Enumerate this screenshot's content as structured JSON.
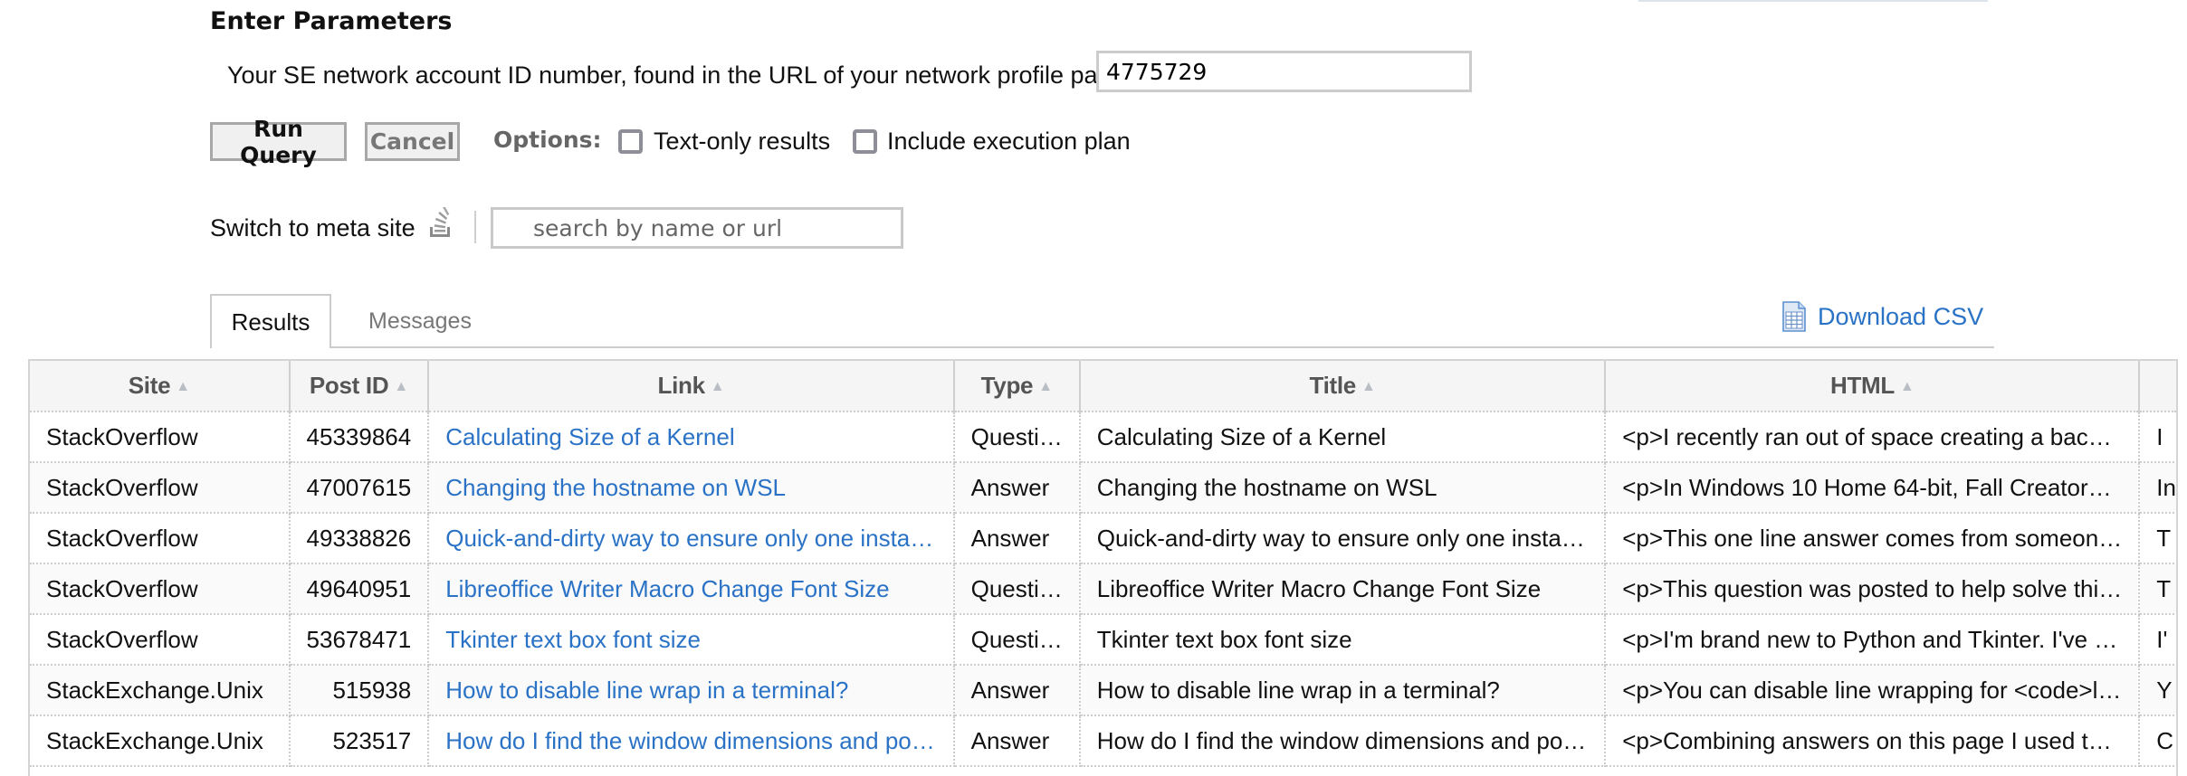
{
  "parameters": {
    "heading": "Enter Parameters",
    "account_label": "Your SE network account ID number, found in the URL of your network profile page:",
    "account_value": "4775729"
  },
  "toolbar": {
    "run_label": "Run Query",
    "cancel_label": "Cancel",
    "options_label": "Options:",
    "options": [
      {
        "label": "Text-only results",
        "checked": false
      },
      {
        "label": "Include execution plan",
        "checked": false
      }
    ]
  },
  "site_switcher": {
    "label": "Switch to meta site",
    "icon": "stackexchange-icon",
    "search_placeholder": "search by name or url"
  },
  "tabs": [
    {
      "label": "Results",
      "active": true
    },
    {
      "label": "Messages",
      "active": false
    }
  ],
  "download_label": "Download CSV",
  "colors": {
    "link": "#2a72c6",
    "header_bg": "#f5f5f5"
  },
  "results": {
    "columns": [
      "Site",
      "Post ID",
      "Link",
      "Type",
      "Title",
      "HTML",
      ""
    ],
    "rows": [
      {
        "site": "StackOverflow",
        "post_id": "45339864",
        "link": "Calculating Size of a Kernel",
        "type": "Questi…",
        "title": "Calculating Size of a Kernel",
        "html": "<p>I recently ran out of space creating a bac…",
        "extra": "I"
      },
      {
        "site": "StackOverflow",
        "post_id": "47007615",
        "link": "Changing the hostname on WSL",
        "type": "Answer",
        "title": "Changing the hostname on WSL",
        "html": "<p>In Windows 10 Home 64-bit, Fall Creator…",
        "extra": "In"
      },
      {
        "site": "StackOverflow",
        "post_id": "49338826",
        "link": "Quick-and-dirty way to ensure only one insta…",
        "type": "Answer",
        "title": "Quick-and-dirty way to ensure only one insta…",
        "html": "<p>This one line answer comes from someon…",
        "extra": "T"
      },
      {
        "site": "StackOverflow",
        "post_id": "49640951",
        "link": "Libreoffice Writer Macro Change Font Size",
        "type": "Questi…",
        "title": "Libreoffice Writer Macro Change Font Size",
        "html": "<p>This question was posted to help solve thi…",
        "extra": "T"
      },
      {
        "site": "StackOverflow",
        "post_id": "53678471",
        "link": "Tkinter text box font size",
        "type": "Questi…",
        "title": "Tkinter text box font size",
        "html": "<p>I'm brand new to Python and Tkinter. I've …",
        "extra": "I'"
      },
      {
        "site": "StackExchange.Unix",
        "post_id": "515938",
        "link": "How to disable line wrap in a terminal?",
        "type": "Answer",
        "title": "How to disable line wrap in a terminal?",
        "html": "<p>You can disable line wrapping for <code>l…",
        "extra": "Y"
      },
      {
        "site": "StackExchange.Unix",
        "post_id": "523517",
        "link": "How do I find the window dimensions and po…",
        "type": "Answer",
        "title": "How do I find the window dimensions and po…",
        "html": "<p>Combining answers on this page I used t…",
        "extra": "C"
      }
    ]
  }
}
